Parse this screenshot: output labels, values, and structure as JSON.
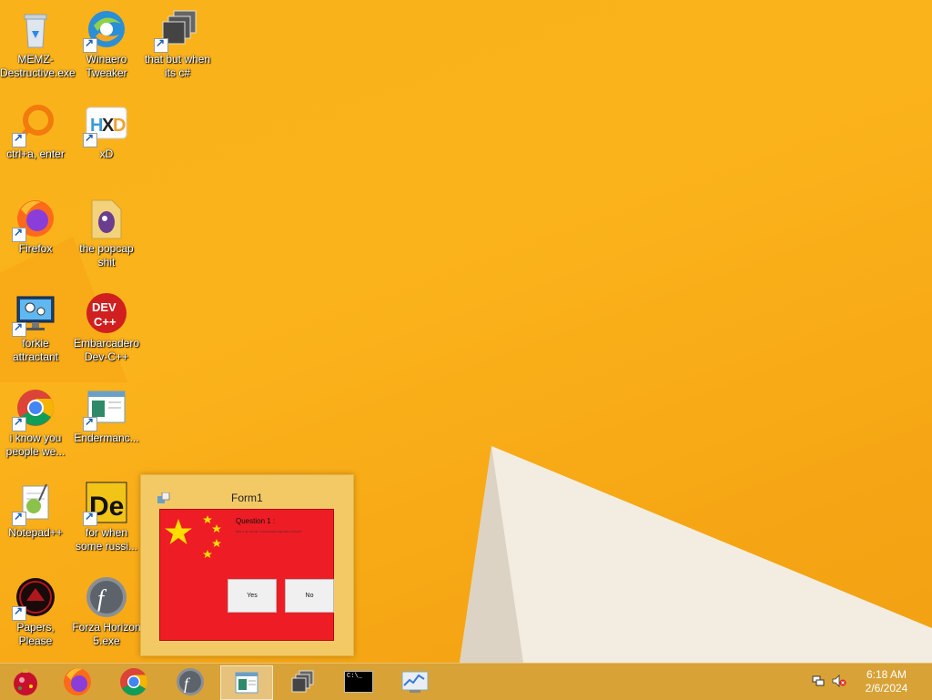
{
  "desktop": {
    "icons": [
      {
        "label": "MEMZ-Destructive.exe",
        "icon": "recycle-bin-icon"
      },
      {
        "label": "Winaero Tweaker",
        "icon": "winaero-icon"
      },
      {
        "label": "that but when its c#",
        "icon": "stacked-windows-icon"
      },
      {
        "label": "ctrl+a, enter",
        "icon": "orange-ring-icon"
      },
      {
        "label": "xD",
        "icon": "hxd-icon"
      },
      {
        "label": "Firefox",
        "icon": "firefox-icon"
      },
      {
        "label": "the popcap shit",
        "icon": "folder-icon"
      },
      {
        "label": "forkie attractant",
        "icon": "monitor-gear-icon"
      },
      {
        "label": "Embarcadero Dev-C++",
        "icon": "devcpp-icon"
      },
      {
        "label": "i know you people we...",
        "icon": "chrome-icon"
      },
      {
        "label": "Endermanc...",
        "icon": "window-app-icon"
      },
      {
        "label": "Notepad++",
        "icon": "notepadpp-icon"
      },
      {
        "label": "for when some russi...",
        "icon": "de-icon"
      },
      {
        "label": "Papers, Please",
        "icon": "papers-please-icon"
      },
      {
        "label": "Forza Horizon 5.exe",
        "icon": "flash-icon"
      }
    ]
  },
  "preview": {
    "title": "Form1",
    "question": "Question 1 :",
    "question_text": "Who is the founder of the People's Republic of China?",
    "yes": "Yes",
    "no": "No"
  },
  "taskbar": {
    "buttons": [
      "start-orb",
      "firefox",
      "chrome",
      "flash",
      "form1-app",
      "stacked-windows",
      "command-prompt",
      "performance-monitor"
    ],
    "cmd_text": "C:\\_"
  },
  "clock": {
    "time": "6:18 AM",
    "date": "2/6/2024"
  },
  "colors": {
    "background": "#fbb31b",
    "flag_red": "#ee1c25",
    "flag_star": "#ffde00"
  }
}
